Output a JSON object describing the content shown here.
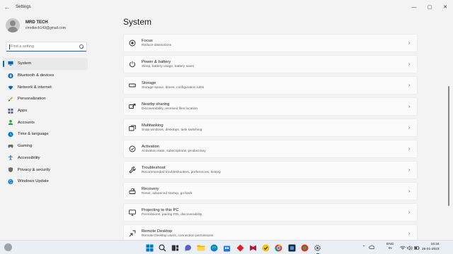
{
  "window": {
    "title": "Settings",
    "back_glyph": "←",
    "controls": {
      "minimize": "—",
      "maximize": "▢",
      "close": "✕"
    }
  },
  "profile": {
    "name": "MRD TECH",
    "email": "cmrdtech143@gmail.com"
  },
  "search": {
    "placeholder": "Find a setting"
  },
  "nav": {
    "items": [
      {
        "label": "System",
        "icon": "monitor-icon",
        "color": "#0067c0",
        "active": true
      },
      {
        "label": "Bluetooth & devices",
        "icon": "bluetooth-icon",
        "color": "#0067c0"
      },
      {
        "label": "Network & internet",
        "icon": "wifi-icon",
        "color": "#0067c0"
      },
      {
        "label": "Personalization",
        "icon": "brush-icon",
        "color": "#e3a21a"
      },
      {
        "label": "Apps",
        "icon": "apps-icon",
        "color": "#5a6b80"
      },
      {
        "label": "Accounts",
        "icon": "person-icon",
        "color": "#2ea043"
      },
      {
        "label": "Time & language",
        "icon": "globe-clock-icon",
        "color": "#0078d4"
      },
      {
        "label": "Gaming",
        "icon": "gamepad-icon",
        "color": "#6b6b6b"
      },
      {
        "label": "Accessibility",
        "icon": "accessibility-icon",
        "color": "#1f6fd1"
      },
      {
        "label": "Privacy & security",
        "icon": "shield-icon",
        "color": "#6b6b6b"
      },
      {
        "label": "Windows Update",
        "icon": "update-icon",
        "color": "#0078d4"
      }
    ]
  },
  "main": {
    "title": "System",
    "cards": [
      {
        "title": "Focus",
        "subtitle": "Reduce distractions",
        "icon": "focus-icon"
      },
      {
        "title": "Power & battery",
        "subtitle": "Sleep, battery usage, battery saver",
        "icon": "power-icon"
      },
      {
        "title": "Storage",
        "subtitle": "Storage space, drives, configuration rules",
        "icon": "storage-icon"
      },
      {
        "title": "Nearby sharing",
        "subtitle": "Discoverability, received files location",
        "icon": "share-icon"
      },
      {
        "title": "Multitasking",
        "subtitle": "Snap windows, desktops, task switching",
        "icon": "multitask-icon"
      },
      {
        "title": "Activation",
        "subtitle": "Activation state, subscriptions, product key",
        "icon": "activation-icon"
      },
      {
        "title": "Troubleshoot",
        "subtitle": "Recommended troubleshooters, preferences, history",
        "icon": "wrench-icon"
      },
      {
        "title": "Recovery",
        "subtitle": "Reset, advanced startup, go back",
        "icon": "recovery-icon"
      },
      {
        "title": "Projecting to this PC",
        "subtitle": "Permissions, pairing PIN, discoverability",
        "icon": "projector-icon"
      },
      {
        "title": "Remote Desktop",
        "subtitle": "Remote Desktop users, connection permissions",
        "icon": "remote-desktop-icon"
      }
    ],
    "chevron": "›"
  },
  "taskbar": {
    "apps": [
      {
        "icon": "windows-start-icon",
        "color": "#0078d4"
      },
      {
        "icon": "search-icon",
        "color": "#333333"
      },
      {
        "icon": "task-view-icon",
        "color": "#333333"
      },
      {
        "icon": "chat-icon",
        "color": "#5b5fc7"
      },
      {
        "icon": "file-explorer-icon",
        "color": "#f2b200"
      },
      {
        "icon": "edge-icon",
        "color": "#0c7cd5"
      },
      {
        "icon": "store-icon",
        "color": "#1a73e8"
      },
      {
        "icon": "red-app-icon",
        "color": "#e02020"
      },
      {
        "icon": "mcafee-icon",
        "color": "#c8102e"
      },
      {
        "icon": "norton-icon",
        "color": "#f5c400"
      },
      {
        "icon": "chrome-icon",
        "color": "#db4437"
      },
      {
        "icon": "dark-app-icon",
        "color": "#1e2a3a"
      },
      {
        "icon": "colorful-app-icon",
        "color": "#e03030"
      },
      {
        "icon": "settings-icon",
        "color": "#555555",
        "running": true
      }
    ],
    "tray": {
      "chevron": "⌃",
      "lang_top": "ENG",
      "lang_bottom": "IN",
      "time": "16:34",
      "date": "26-01-2023"
    }
  }
}
